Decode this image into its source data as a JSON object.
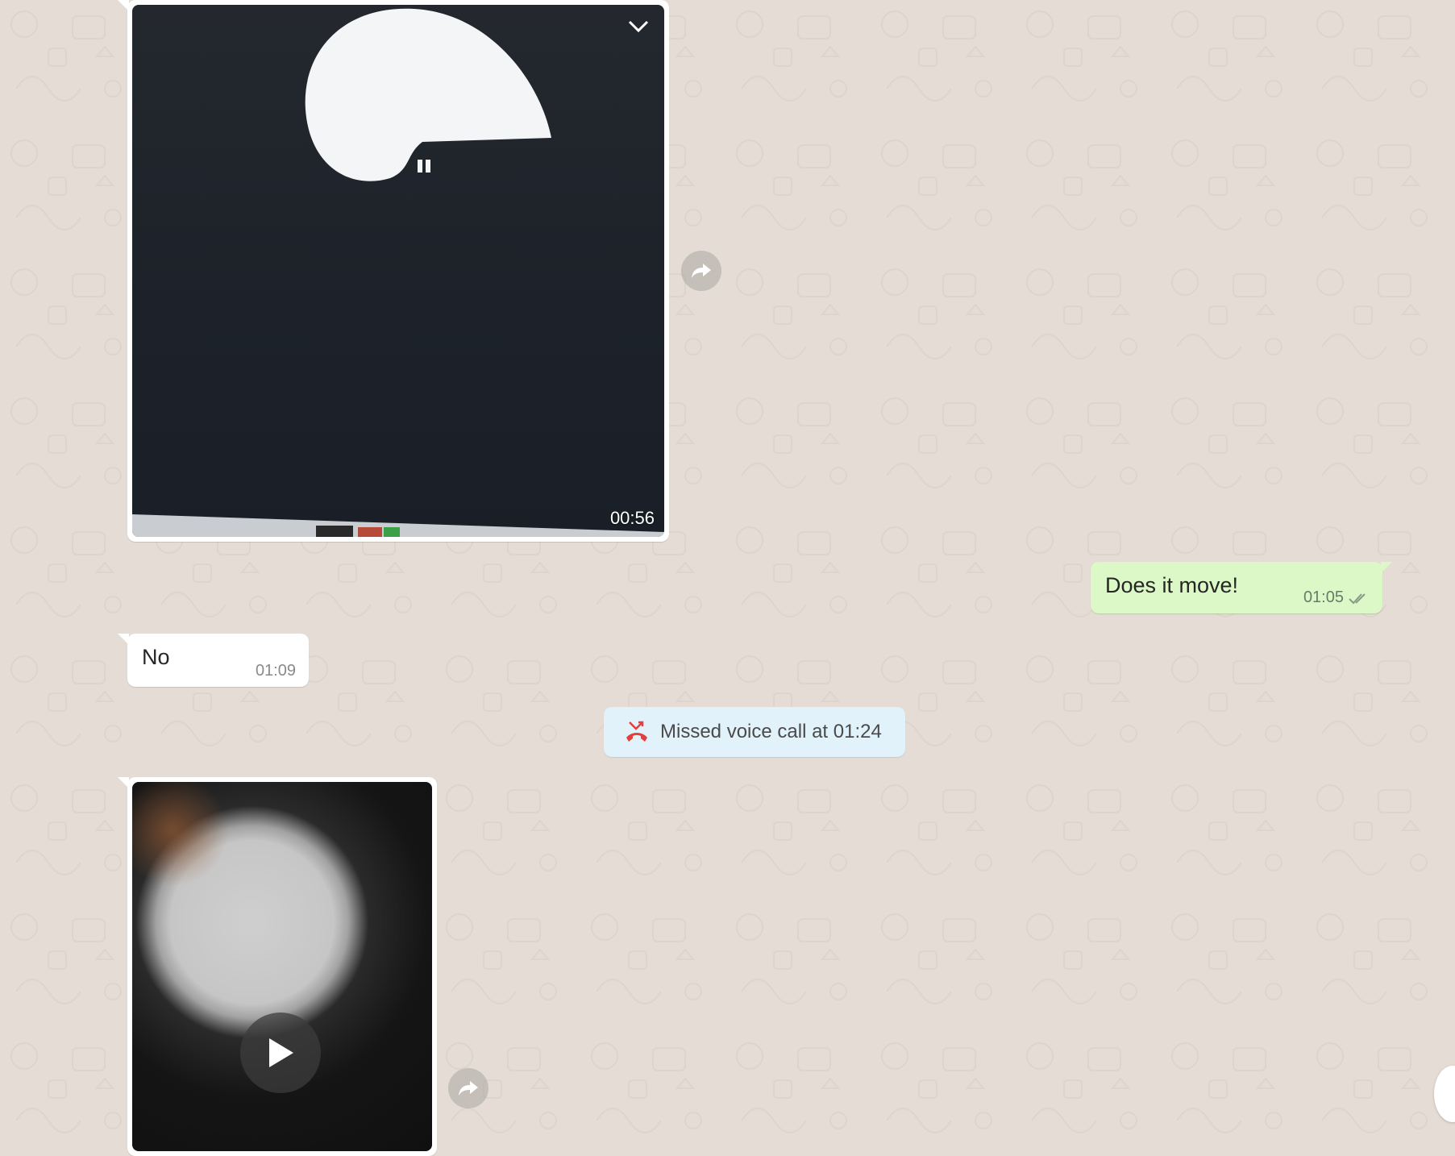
{
  "theme": {
    "wallpaper": "#e5ddd5",
    "incoming": "#ffffff",
    "outgoing": "#dcf8c6",
    "system": "#e1f2fb",
    "missed_red": "#e53e3e"
  },
  "messages": {
    "video1": {
      "duration": "00:56",
      "icon": "chevron-down-icon"
    },
    "outgoing": {
      "text": "Does it move!",
      "time": "01:05",
      "status_icon": "double-check-icon"
    },
    "incoming": {
      "text": "No",
      "time": "01:09"
    },
    "missed_call": {
      "icon": "missed-call-icon",
      "text": "Missed voice call at 01:24"
    },
    "video2": {
      "icon": "play-icon"
    }
  }
}
